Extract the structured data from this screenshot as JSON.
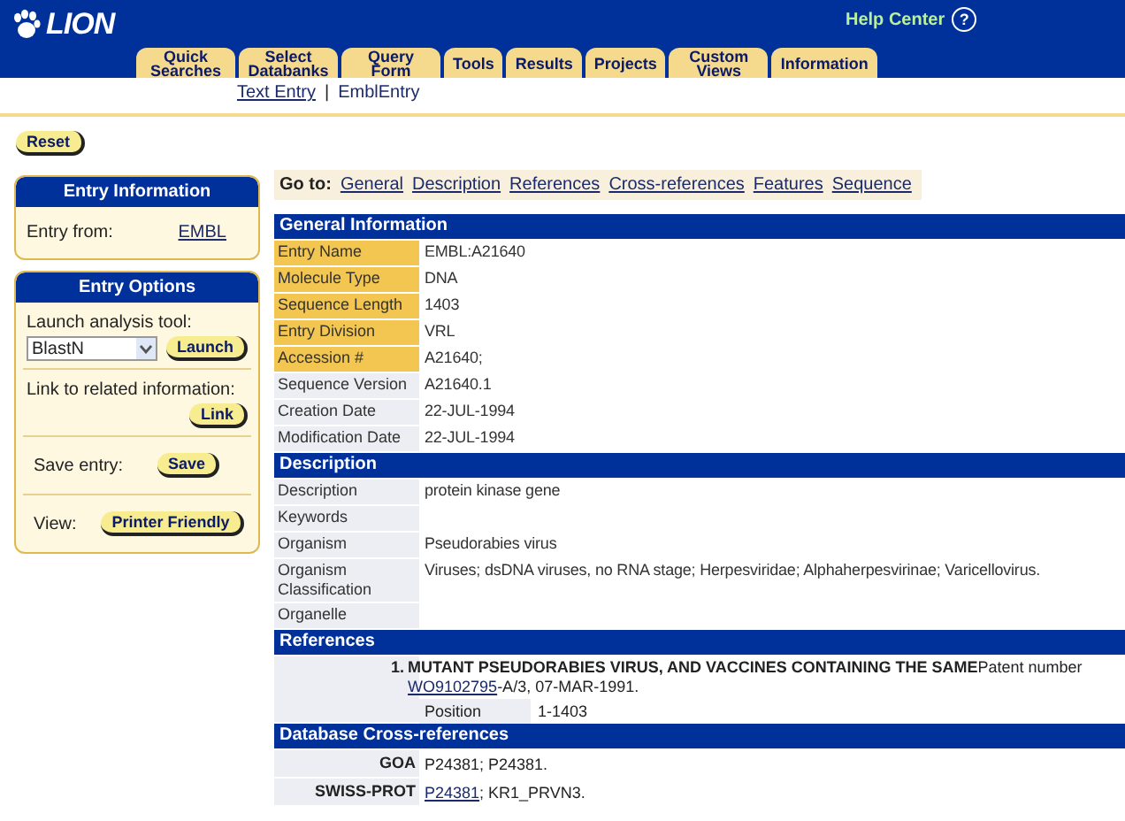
{
  "header": {
    "logo": "LION",
    "help": "Help Center",
    "help_icon": "?"
  },
  "tabs": [
    {
      "label": "Quick Searches",
      "selected": false
    },
    {
      "label": "Select Databanks",
      "selected": false
    },
    {
      "label": "Query Form",
      "selected": false
    },
    {
      "label": "Tools",
      "selected": false
    },
    {
      "label": "Results",
      "selected": false
    },
    {
      "label": "Projects",
      "selected": false
    },
    {
      "label": "Custom Views",
      "selected": false
    },
    {
      "label": "Information",
      "selected": false
    }
  ],
  "breadcrumb": {
    "link": "Text Entry",
    "separator": "|",
    "current": "EmblEntry"
  },
  "reset_button": "Reset",
  "entry_information": {
    "title": "Entry Information",
    "label": "Entry from:",
    "link": "EMBL"
  },
  "entry_options": {
    "title": "Entry Options",
    "launch_label": "Launch analysis tool:",
    "tool_select": "BlastN",
    "launch_button": "Launch",
    "link_label": "Link to related information:",
    "link_button": "Link",
    "save_label": "Save entry:",
    "save_button": "Save",
    "view_label": "View:",
    "view_button": "Printer Friendly"
  },
  "goto": {
    "label": "Go to:",
    "links": [
      "General",
      "Description",
      "References",
      "Cross-references",
      "Features",
      "Sequence"
    ]
  },
  "sections": [
    {
      "title": "General Information",
      "kind": "fields",
      "rows": [
        {
          "label": "Entry Name",
          "value": "EMBL:A21640",
          "highlighted": true
        },
        {
          "label": "Molecule Type",
          "value": "DNA",
          "highlighted": true
        },
        {
          "label": "Sequence Length",
          "value": "1403",
          "highlighted": true
        },
        {
          "label": "Entry Division",
          "value": "VRL",
          "highlighted": true
        },
        {
          "label": "Accession #",
          "value": "A21640;",
          "highlighted": true
        },
        {
          "label": "Sequence Version",
          "value": "A21640.1",
          "highlighted": false
        },
        {
          "label": "Creation Date",
          "value": "22-JUL-1994",
          "highlighted": false
        },
        {
          "label": "Modification Date",
          "value": "22-JUL-1994",
          "highlighted": false
        }
      ]
    },
    {
      "title": "Description",
      "kind": "fields",
      "rows": [
        {
          "label": "Description",
          "value": "protein kinase gene",
          "highlighted": false
        },
        {
          "label": "Keywords",
          "highlighted": false
        },
        {
          "label": "Organism",
          "value": "Pseudorabies virus",
          "highlighted": false
        },
        {
          "label": "Organism Classification",
          "value": "Viruses; dsDNA viruses, no RNA stage; Herpesviridae; Alphaherpesvirinae; Varicellovirus.",
          "highlighted": false
        },
        {
          "label": "Organelle",
          "highlighted": false
        }
      ]
    },
    {
      "title": "References",
      "kind": "references",
      "items": [
        {
          "number": "1.",
          "text": "**MUTANT PSEUDORABIES VIRUS, AND VACCINES CONTAINING THE SAME**Patent number",
          "link": "WO9102795",
          "text_after": "-A/3, 07-MAR-1991.",
          "position_label": "Position",
          "position": "1-1403"
        }
      ]
    },
    {
      "title": "Database Cross-references",
      "kind": "xrefs",
      "rows": [
        {
          "database": "GOA",
          "value": "P24381; P24381."
        },
        {
          "database": "SWISS-PROT",
          "link": "P24381",
          "value": "; KR1_PRVN3."
        }
      ]
    }
  ]
}
